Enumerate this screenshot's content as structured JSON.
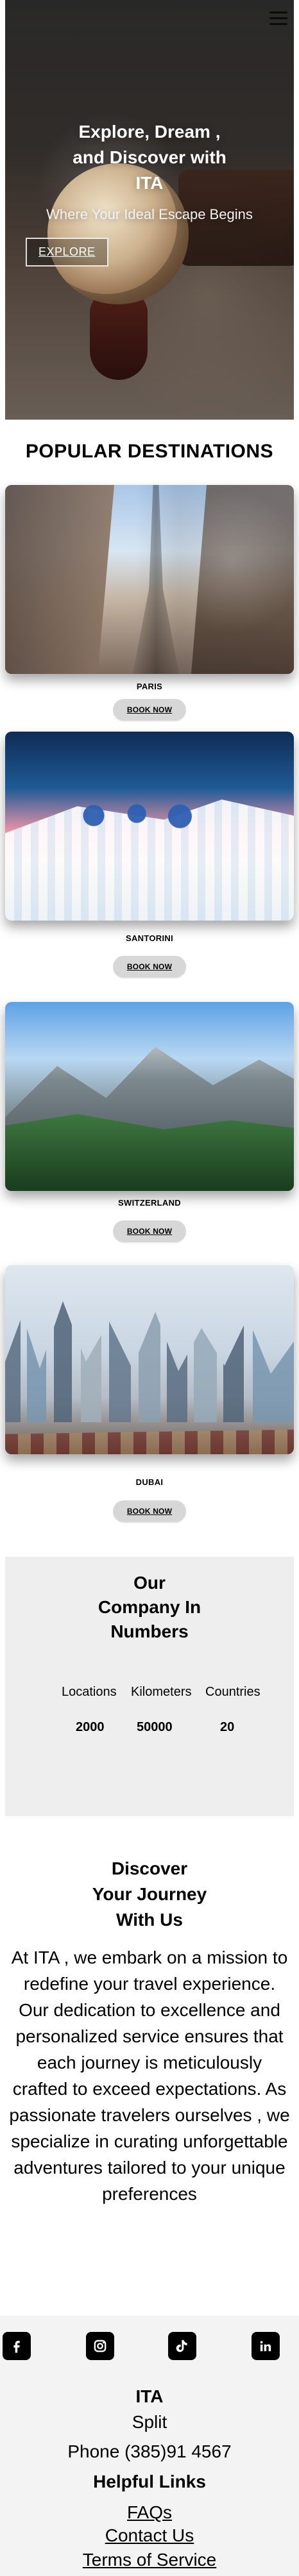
{
  "nav": {
    "menu_icon": "hamburger-menu-icon"
  },
  "hero": {
    "title": "Explore, Dream ,\nand Discover with\nITA",
    "subtitle": "Where Your Ideal Escape Begins",
    "cta_label": "EXPLORE"
  },
  "popular": {
    "title": "POPULAR DESTINATIONS",
    "items": [
      {
        "label": "PARIS",
        "button": "BOOK NOW"
      },
      {
        "label": "SANTORINI",
        "button": "BOOK NOW"
      },
      {
        "label": "SWITZERLAND",
        "button": "BOOK NOW"
      },
      {
        "label": "DUBAI",
        "button": "BOOK NOW"
      }
    ]
  },
  "numbers": {
    "title": "Our\nCompany In\nNumbers",
    "headers": [
      "Locations",
      "Kilometers",
      "Countries"
    ],
    "values": [
      "2000",
      "50000",
      "20"
    ]
  },
  "discover": {
    "title": "Discover\nYour Journey\nWith Us",
    "text": "At ITA , we embark on a mission to redefine your travel experience. Our dedication to excellence and personalized service ensures that each journey is meticulously crafted to exceed expectations. As passionate travelers ourselves , we specialize in curating unforgettable adventures tailored to your unique preferences"
  },
  "footer": {
    "social_icons": [
      "facebook-icon",
      "instagram-icon",
      "tiktok-icon",
      "linkedin-icon"
    ],
    "brand": "ITA",
    "city": "Split",
    "phone": "Phone (385)91 4567",
    "helpful_title": "Helpful Links",
    "links": [
      "FAQs",
      "Contact Us",
      "Terms of Service"
    ]
  }
}
